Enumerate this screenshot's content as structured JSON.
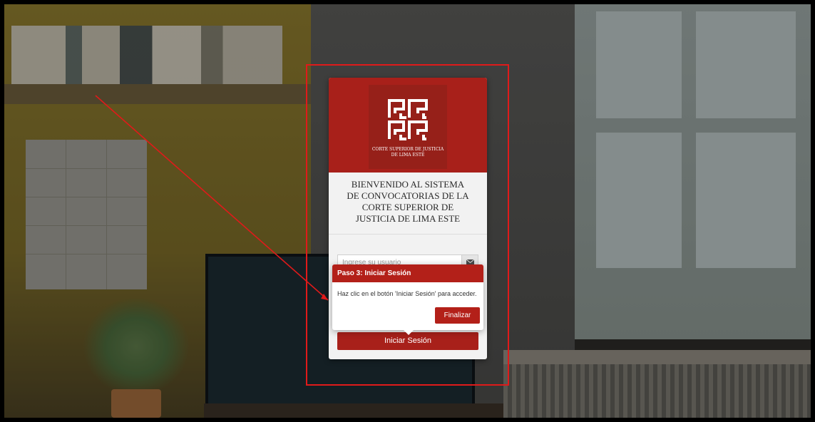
{
  "login": {
    "logo": {
      "icon": "csj-logo-icon",
      "caption_line1": "CORTE SUPERIOR DE JUSTICIA",
      "caption_line2": "DE LIMA ESTE"
    },
    "welcome_lines": [
      "BIENVENIDO AL SISTEMA",
      "DE CONVOCATORIAS DE LA",
      "CORTE SUPERIOR DE",
      "JUSTICIA DE LIMA ESTE"
    ],
    "user_field": {
      "placeholder": "Ingrese su usuario",
      "icon": "envelope-icon"
    },
    "login_button": "Iniciar Sesión"
  },
  "tour": {
    "title": "Paso 3: Iniciar Sesión",
    "body": "Haz clic en el botón 'Iniciar Sesión' para acceder.",
    "finish_button": "Finalizar"
  },
  "colors": {
    "brand": "#a8201a",
    "annotation": "#e01a1a"
  }
}
